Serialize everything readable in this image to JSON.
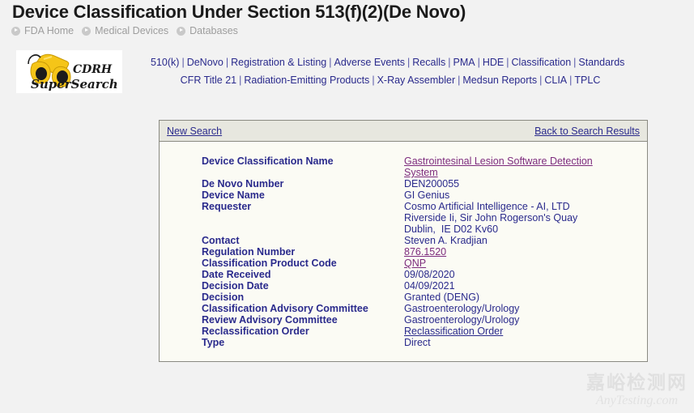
{
  "header": {
    "title": "Device Classification Under Section 513(f)(2)(De Novo)",
    "breadcrumb": [
      {
        "label": "FDA Home",
        "icon": "chevron-circle-right-icon"
      },
      {
        "label": "Medical Devices",
        "icon": "chevron-circle-right-icon"
      },
      {
        "label": "Databases",
        "icon": "chevron-circle-right-icon"
      }
    ]
  },
  "logo": {
    "name": "cdrh-supersearch-logo",
    "line1": "CDRH",
    "line2": "SuperSearch",
    "icon": "binoculars-icon",
    "colors": {
      "body": "#f5c518",
      "highlight": "#ffe680",
      "shadow": "#c99a06",
      "text": "#1a1a1a"
    }
  },
  "nav": {
    "row1": [
      "510(k)",
      "DeNovo",
      "Registration & Listing",
      "Adverse Events",
      "Recalls",
      "PMA",
      "HDE",
      "Classification",
      "Standards"
    ],
    "row2": [
      "CFR Title 21",
      "Radiation-Emitting Products",
      "X-Ray Assembler",
      "Medsun Reports",
      "CLIA",
      "TPLC"
    ],
    "separator": "|"
  },
  "panel": {
    "new_search_label": "New Search",
    "back_to_results_label": "Back to Search Results",
    "rows": [
      {
        "label": "Device Classification Name",
        "lines": [
          "Gastrointesinal Lesion Software Detection",
          "System"
        ],
        "type": "link-visited",
        "gap": true
      },
      {
        "label": "De Novo Number",
        "lines": [
          "DEN200055"
        ],
        "type": "text"
      },
      {
        "label": "Device Name",
        "lines": [
          "GI Genius"
        ],
        "type": "text"
      },
      {
        "label": "Requester",
        "lines": [
          "Cosmo Artificial Intelligence - AI, LTD",
          "Riverside Ii, Sir John Rogerson's Quay",
          "Dublin,  IE D02 Kv60"
        ],
        "type": "text",
        "gap": true
      },
      {
        "label": "Contact",
        "lines": [
          "Steven A. Kradjian"
        ],
        "type": "text",
        "gap": true
      },
      {
        "label": "Regulation Number",
        "lines": [
          "876.1520"
        ],
        "type": "link-visited"
      },
      {
        "label": "Classification Product Code",
        "lines": [
          "QNP"
        ],
        "type": "link-visited"
      },
      {
        "label": "Date Received",
        "lines": [
          "09/08/2020"
        ],
        "type": "text"
      },
      {
        "label": "Decision Date",
        "lines": [
          "04/09/2021"
        ],
        "type": "text"
      },
      {
        "label": "Decision",
        "lines": [
          "Granted (DENG)"
        ],
        "type": "text"
      },
      {
        "label": "Classification Advisory Committee",
        "lines": [
          "Gastroenterology/Urology"
        ],
        "type": "text"
      },
      {
        "label": "Review Advisory Committee",
        "lines": [
          "Gastroenterology/Urology"
        ],
        "type": "text"
      },
      {
        "label": "Reclassification Order",
        "lines": [
          "Reclassification Order"
        ],
        "type": "link-new"
      },
      {
        "label": "Type",
        "lines": [
          "Direct"
        ],
        "type": "text"
      }
    ]
  },
  "watermark": {
    "chinese": "嘉峪检测网",
    "english": "AnyTesting.com"
  },
  "colors": {
    "page_background": "#f2f2f2",
    "panel_background": "#fbfbf4",
    "panel_header_background": "#e7e7df",
    "panel_border": "#8a8a82",
    "link_new": "#2a2a8c",
    "link_visited": "#7d2b7d",
    "label_text": "#2a2a8c",
    "title_text": "#1b1b1b",
    "breadcrumb_text": "#9a9a9a"
  }
}
